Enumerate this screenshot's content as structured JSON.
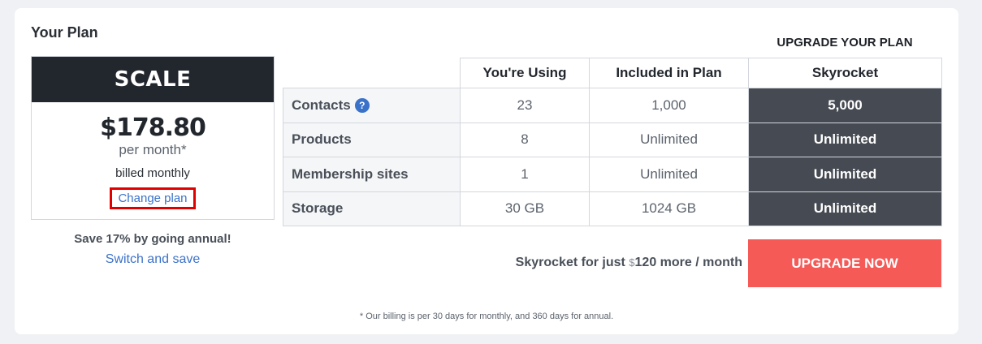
{
  "card": {
    "title": "Your Plan"
  },
  "plan": {
    "name": "SCALE",
    "price": "$178.80",
    "period": "per month*",
    "billing": "billed monthly",
    "change_link": "Change plan"
  },
  "annual": {
    "save_text": "Save 17% by going annual!",
    "switch_link": "Switch and save"
  },
  "upgrade": {
    "heading": "UPGRADE YOUR PLAN",
    "promo_prefix": "Skyrocket for just ",
    "promo_currency": "$",
    "promo_amount": "120 more / month",
    "button_label": "UPGRADE NOW",
    "button_color": "#f55a57"
  },
  "table": {
    "headers": [
      "You're Using",
      "Included in Plan",
      "Skyrocket"
    ],
    "rows": [
      {
        "label": "Contacts",
        "using": "23",
        "included": "1,000",
        "skyrocket": "5,000",
        "help_icon": "?"
      },
      {
        "label": "Products",
        "using": "8",
        "included": "Unlimited",
        "skyrocket": "Unlimited"
      },
      {
        "label": "Membership sites",
        "using": "1",
        "included": "Unlimited",
        "skyrocket": "Unlimited"
      },
      {
        "label": "Storage",
        "using": "30 GB",
        "included": "1024 GB",
        "skyrocket": "Unlimited"
      }
    ]
  },
  "footnote": "* Our billing is per 30 days for monthly, and 360 days for annual.",
  "colors": {
    "link": "#3b72c9",
    "dark_header": "#22262d",
    "skyrocket_column": "#464a52",
    "highlight_border": "#e00000"
  }
}
